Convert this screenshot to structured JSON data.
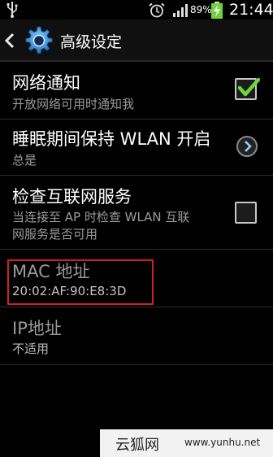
{
  "statusbar": {
    "battery_percent": "89%",
    "time": "21:44"
  },
  "header": {
    "title": "高级设定"
  },
  "settings": {
    "network_notify": {
      "title": "网络通知",
      "subtitle": "开放网络可用时通知我",
      "checked": true
    },
    "wlan_sleep": {
      "title": "睡眠期间保持 WLAN 开启",
      "subtitle": "总是"
    },
    "internet_check": {
      "title": "检查互联网服务",
      "subtitle_line1": "当连接至 AP 时检查 WLAN 互联",
      "subtitle_line2": "网服务是否可用",
      "checked": false
    },
    "mac_address": {
      "title": "MAC 地址",
      "value": "20:02:AF:90:E8:3D"
    },
    "ip_address": {
      "title": "IP地址",
      "value": "不适用"
    }
  },
  "watermark": {
    "brand": "云狐网",
    "url": "www.yunhu.net"
  },
  "colors": {
    "accent_check": "#6fd43a",
    "highlight_red": "#d2202b",
    "gear_blue": "#2f8fd8"
  }
}
